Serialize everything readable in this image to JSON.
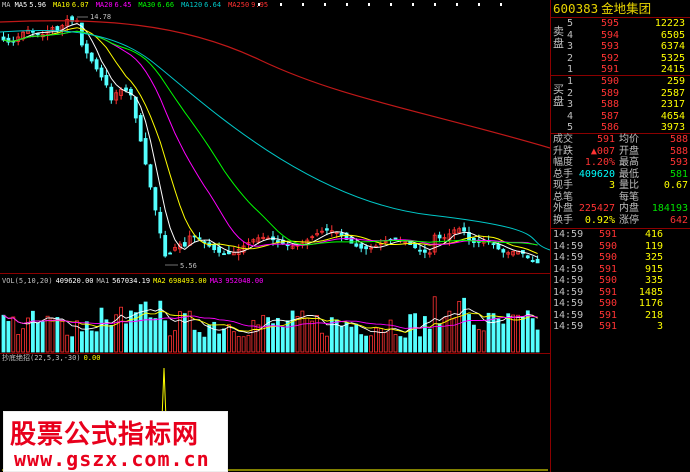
{
  "main_legend": [
    {
      "label": "MA",
      "value": "",
      "color": "#c0c0c0"
    },
    {
      "label": "MA5",
      "value": "5.96",
      "color": "#ffffff"
    },
    {
      "label": "MA10",
      "value": "6.07",
      "color": "#ffff00"
    },
    {
      "label": "MA20",
      "value": "6.45",
      "color": "#ff00ff"
    },
    {
      "label": "MA30",
      "value": "6.66",
      "color": "#00ff00"
    },
    {
      "label": "MA120",
      "value": "6.64",
      "color": "#00c8c8"
    },
    {
      "label": "MA250",
      "value": "9.95",
      "color": "#ff3030"
    }
  ],
  "price_high_label": "14.78",
  "price_low_label": "5.56",
  "vol_legend": {
    "name": "VOL(5,10,20)",
    "vol": "409620.00",
    "ma1_label": "MA1",
    "ma1": "567034.19",
    "ma2_label": "MA2",
    "ma2": "698493.00",
    "ma3_label": "MA3",
    "ma3": "952048.00"
  },
  "ind_legend": {
    "name": "抄底绝招(22,5,3,-30)",
    "value": "0.00"
  },
  "stock": {
    "code": "600383",
    "name": "金地集团"
  },
  "ask_label": "卖盘",
  "bid_label": "买盘",
  "asks": [
    {
      "n": "5",
      "price": "595",
      "vol": "12223"
    },
    {
      "n": "4",
      "price": "594",
      "vol": "6505"
    },
    {
      "n": "3",
      "price": "593",
      "vol": "6374"
    },
    {
      "n": "2",
      "price": "592",
      "vol": "5325"
    },
    {
      "n": "1",
      "price": "591",
      "vol": "2415"
    }
  ],
  "bids": [
    {
      "n": "1",
      "price": "590",
      "vol": "259"
    },
    {
      "n": "2",
      "price": "589",
      "vol": "2587"
    },
    {
      "n": "3",
      "price": "588",
      "vol": "2317"
    },
    {
      "n": "4",
      "price": "587",
      "vol": "4654"
    },
    {
      "n": "5",
      "price": "586",
      "vol": "3973"
    }
  ],
  "stats": [
    {
      "l1": "成交",
      "v1": "591",
      "c1": "red",
      "l2": "均价",
      "v2": "588",
      "c2": "red"
    },
    {
      "l1": "升跌",
      "v1": "▲007",
      "c1": "red",
      "l2": "开盘",
      "v2": "588",
      "c2": "red"
    },
    {
      "l1": "幅度",
      "v1": "1.20%",
      "c1": "red",
      "l2": "最高",
      "v2": "593",
      "c2": "red"
    },
    {
      "l1": "总手",
      "v1": "409620",
      "c1": "cy",
      "l2": "最低",
      "v2": "581",
      "c2": "green"
    },
    {
      "l1": "现手",
      "v1": "3",
      "c1": "yel",
      "l2": "量比",
      "v2": "0.67",
      "c2": "yel"
    },
    {
      "l1": "总笔",
      "v1": "",
      "c1": "wh",
      "l2": "每笔",
      "v2": "",
      "c2": "wh"
    },
    {
      "l1": "外盘",
      "v1": "225427",
      "c1": "red",
      "l2": "内盘",
      "v2": "184193",
      "c2": "green"
    },
    {
      "l1": "换手",
      "v1": "0.92%",
      "c1": "yel",
      "l2": "涨停",
      "v2": "642",
      "c2": "red"
    }
  ],
  "ticks": [
    {
      "time": "14:59",
      "price": "591",
      "vol": "416"
    },
    {
      "time": "14:59",
      "price": "590",
      "vol": "119"
    },
    {
      "time": "14:59",
      "price": "590",
      "vol": "325"
    },
    {
      "time": "14:59",
      "price": "591",
      "vol": "915"
    },
    {
      "time": "14:59",
      "price": "590",
      "vol": "335"
    },
    {
      "time": "14:59",
      "price": "591",
      "vol": "1485"
    },
    {
      "time": "14:59",
      "price": "590",
      "vol": "1176"
    },
    {
      "time": "14:59",
      "price": "591",
      "vol": "218"
    },
    {
      "time": "14:59",
      "price": "591",
      "vol": "3"
    }
  ],
  "watermark": {
    "line1": "股票公式指标网",
    "line2": "www.gszx.com.cn"
  }
}
